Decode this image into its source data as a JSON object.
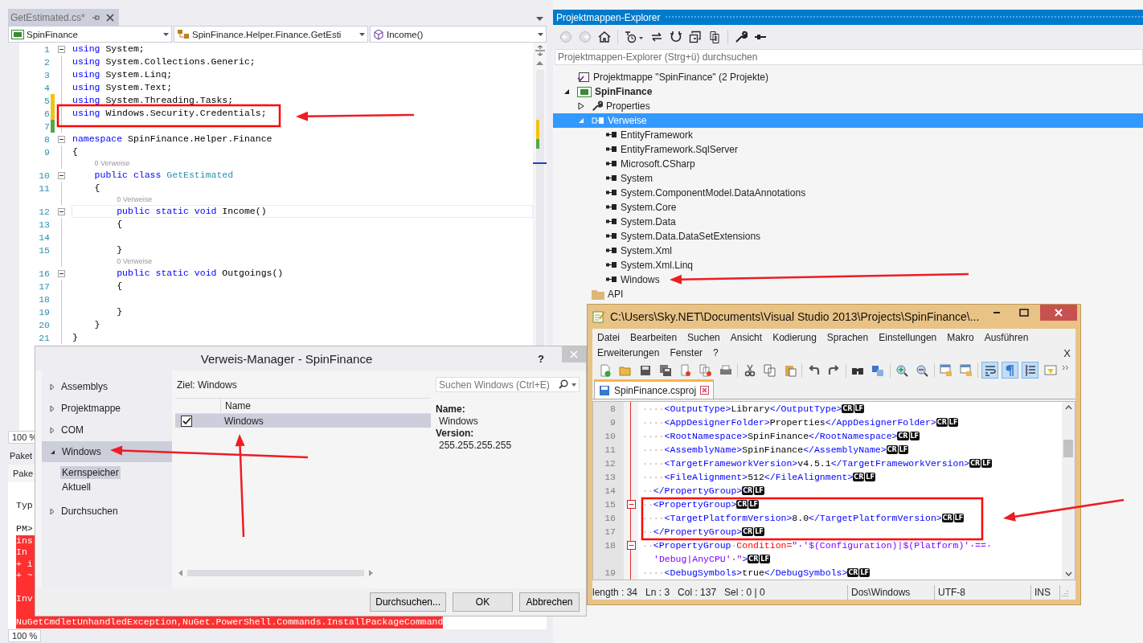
{
  "editor": {
    "tab": {
      "title": "GetEstimated.cs*",
      "selected": true
    },
    "navigation": [
      {
        "kind": "project",
        "text": "SpinFinance"
      },
      {
        "kind": "class",
        "text": "SpinFinance.Helper.Finance.GetEsti"
      },
      {
        "kind": "method",
        "text": "Income()"
      }
    ],
    "lines": [
      {
        "kind": "code",
        "number": "1",
        "fold": true,
        "modified": false,
        "current": false,
        "segments": [
          {
            "kind": "keyword",
            "text": "using"
          },
          {
            "kind": "plain",
            "text": " System;"
          }
        ]
      },
      {
        "kind": "code",
        "number": "2",
        "fold": false,
        "modified": false,
        "current": false,
        "segments": [
          {
            "kind": "keyword",
            "text": "using"
          },
          {
            "kind": "plain",
            "text": " System.Collections.Generic;"
          }
        ]
      },
      {
        "kind": "code",
        "number": "3",
        "fold": false,
        "modified": false,
        "current": false,
        "segments": [
          {
            "kind": "keyword",
            "text": "using"
          },
          {
            "kind": "plain",
            "text": " System.Linq;"
          }
        ]
      },
      {
        "kind": "code",
        "number": "4",
        "fold": false,
        "modified": false,
        "current": false,
        "segments": [
          {
            "kind": "keyword",
            "text": "using"
          },
          {
            "kind": "plain",
            "text": " System.Text;"
          }
        ]
      },
      {
        "kind": "code",
        "number": "5",
        "fold": false,
        "modified": true,
        "saved": false,
        "current": false,
        "segments": [
          {
            "kind": "keyword",
            "text": "using"
          },
          {
            "kind": "plain",
            "text": " System.Threading.Tasks;"
          }
        ]
      },
      {
        "kind": "code",
        "number": "6",
        "fold": false,
        "modified": true,
        "saved": false,
        "current": false,
        "segments": [
          {
            "kind": "keyword",
            "text": "using"
          },
          {
            "kind": "plain",
            "text": " Windows.Security.Credentials;"
          }
        ]
      },
      {
        "kind": "code",
        "number": "7",
        "fold": false,
        "modified": true,
        "saved": true,
        "current": false
      },
      {
        "kind": "code",
        "number": "8",
        "fold": true,
        "modified": false,
        "current": false,
        "segments": [
          {
            "kind": "keyword",
            "text": "namespace"
          },
          {
            "kind": "plain",
            "text": " SpinFinance.Helper.Finance"
          }
        ]
      },
      {
        "kind": "code",
        "number": "9",
        "fold": false,
        "modified": false,
        "current": false,
        "segments": [
          {
            "kind": "plain",
            "text": "{"
          }
        ]
      },
      {
        "kind": "codelens",
        "text": "0 Verweise"
      },
      {
        "kind": "code",
        "number": "10",
        "fold": true,
        "modified": false,
        "current": false,
        "segments": [
          {
            "kind": "keyword",
            "text": "    public class"
          },
          {
            "kind": "type",
            "text": " GetEstimated"
          }
        ]
      },
      {
        "kind": "code",
        "number": "11",
        "fold": false,
        "modified": false,
        "current": false,
        "segments": [
          {
            "kind": "plain",
            "text": "    {"
          }
        ]
      },
      {
        "kind": "codelens",
        "text": "0 Verweise"
      },
      {
        "kind": "code",
        "number": "12",
        "fold": true,
        "modified": false,
        "current": true,
        "segments": [
          {
            "kind": "keyword",
            "text": "        public static void"
          },
          {
            "kind": "plain",
            "text": " Income()"
          }
        ]
      },
      {
        "kind": "code",
        "number": "13",
        "fold": false,
        "modified": false,
        "current": false,
        "segments": [
          {
            "kind": "plain",
            "text": "        {"
          }
        ]
      },
      {
        "kind": "code",
        "number": "14",
        "fold": false,
        "modified": false,
        "current": false
      },
      {
        "kind": "code",
        "number": "15",
        "fold": false,
        "modified": false,
        "current": false,
        "segments": [
          {
            "kind": "plain",
            "text": "        }"
          }
        ]
      },
      {
        "kind": "codelens",
        "text": "0 Verweise"
      },
      {
        "kind": "code",
        "number": "16",
        "fold": true,
        "modified": false,
        "current": false,
        "segments": [
          {
            "kind": "keyword",
            "text": "        public static void"
          },
          {
            "kind": "plain",
            "text": " Outgoings()"
          }
        ]
      },
      {
        "kind": "code",
        "number": "17",
        "fold": false,
        "modified": false,
        "current": false,
        "segments": [
          {
            "kind": "plain",
            "text": "        {"
          }
        ]
      },
      {
        "kind": "code",
        "number": "18",
        "fold": false,
        "modified": false,
        "current": false
      },
      {
        "kind": "code",
        "number": "19",
        "fold": false,
        "modified": false,
        "current": false,
        "segments": [
          {
            "kind": "plain",
            "text": "        }"
          }
        ]
      },
      {
        "kind": "code",
        "number": "20",
        "fold": false,
        "modified": false,
        "current": false,
        "segments": [
          {
            "kind": "plain",
            "text": "    }"
          }
        ]
      },
      {
        "kind": "code",
        "number": "21",
        "fold": false,
        "modified": false,
        "current": false,
        "segments": [
          {
            "kind": "plain",
            "text": "}"
          }
        ]
      }
    ],
    "zoom": "100 %"
  },
  "console": {
    "title": "Paket",
    "toolbar_label": "Pake",
    "lines": [
      {
        "kind": "hint",
        "text": "Typ"
      },
      {
        "kind": "plain",
        "text": "PM>"
      },
      {
        "kind": "error",
        "text": "ins"
      },
      {
        "kind": "error",
        "text": "In"
      },
      {
        "kind": "error",
        "text": "+ i"
      },
      {
        "kind": "error",
        "text": "+ ~"
      },
      {
        "kind": "error"
      },
      {
        "kind": "error",
        "text": "Inv"
      },
      {
        "kind": "error"
      },
      {
        "kind": "error",
        "text": "NuGetCmdletUnhandledException,NuGet.PowerShell.Commands.InstallPackageCommand"
      }
    ],
    "zoom": "100 %"
  },
  "explorer": {
    "title": "Projektmappen-Explorer",
    "search": {
      "placeholder": "Projektmappen-Explorer (Strg+ü) durchsuchen"
    },
    "tree": [
      {
        "label": "Projektmappe \"SpinFinance\" (2 Projekte)",
        "kind": "solution",
        "selected": false,
        "children": [
          {
            "label": "SpinFinance",
            "kind": "project",
            "expanded": true,
            "selected": false,
            "children": [
              {
                "label": "Properties",
                "kind": "properties",
                "expanded": false,
                "selected": false
              },
              {
                "label": "Verweise",
                "kind": "references",
                "expanded": true,
                "selected": true,
                "children": [
                  {
                    "label": "EntityFramework",
                    "kind": "reference",
                    "selected": false
                  },
                  {
                    "label": "EntityFramework.SqlServer",
                    "kind": "reference",
                    "selected": false
                  },
                  {
                    "label": "Microsoft.CSharp",
                    "kind": "reference",
                    "selected": false
                  },
                  {
                    "label": "System",
                    "kind": "reference",
                    "selected": false
                  },
                  {
                    "label": "System.ComponentModel.DataAnnotations",
                    "kind": "reference",
                    "selected": false
                  },
                  {
                    "label": "System.Core",
                    "kind": "reference",
                    "selected": false
                  },
                  {
                    "label": "System.Data",
                    "kind": "reference",
                    "selected": false
                  },
                  {
                    "label": "System.Data.DataSetExtensions",
                    "kind": "reference",
                    "selected": false
                  },
                  {
                    "label": "System.Xml",
                    "kind": "reference",
                    "selected": false
                  },
                  {
                    "label": "System.Xml.Linq",
                    "kind": "reference",
                    "selected": false
                  },
                  {
                    "label": "Windows",
                    "kind": "reference",
                    "selected": false
                  }
                ]
              },
              {
                "label": "API",
                "kind": "folder",
                "selected": false
              }
            ]
          }
        ]
      }
    ]
  },
  "dialog": {
    "title": "Verweis-Manager - SpinFinance",
    "help": "?",
    "nav": [
      {
        "label": "Assemblys",
        "expanded": false,
        "selected": false
      },
      {
        "label": "Projektmappe",
        "expanded": false,
        "selected": false
      },
      {
        "label": "COM",
        "expanded": false,
        "selected": false
      },
      {
        "label": "Windows",
        "expanded": true,
        "selected": true,
        "children": [
          {
            "label": "Kernspeicher",
            "selected": true
          },
          {
            "label": "Aktuell",
            "selected": false
          }
        ]
      },
      {
        "label": "Durchsuchen",
        "expanded": false,
        "selected": false
      }
    ],
    "target": "Ziel: Windows",
    "columns": [
      "Name"
    ],
    "rows": [
      {
        "name": "Windows",
        "checked": true,
        "selected": true
      }
    ],
    "search": {
      "placeholder": "Suchen Windows (Ctrl+E)"
    },
    "details": [
      {
        "label": "Name:",
        "value": "Windows"
      },
      {
        "label": "Version:",
        "value": "255.255.255.255"
      }
    ],
    "buttons": [
      "Durchsuchen...",
      "OK",
      "Abbrechen"
    ]
  },
  "notepad": {
    "title": "C:\\Users\\Sky.NET\\Documents\\Visual Studio 2013\\Projects\\SpinFinance\\...",
    "menus": [
      "Datei",
      "Bearbeiten",
      "Suchen",
      "Ansicht",
      "Kodierung",
      "Sprachen",
      "Einstellungen",
      "Makro",
      "Ausführen",
      "Erweiterungen",
      "Fenster",
      "?"
    ],
    "close_document": "X",
    "toolbar": [
      {
        "kind": "new",
        "on": false
      },
      {
        "kind": "open",
        "on": false
      },
      {
        "kind": "save",
        "on": false
      },
      {
        "kind": "save-all",
        "on": false
      },
      {
        "kind": "close",
        "on": false
      },
      {
        "kind": "close-all",
        "on": false
      },
      {
        "kind": "print",
        "on": false
      },
      {
        "kind": "cut",
        "on": false
      },
      {
        "kind": "copy",
        "on": false
      },
      {
        "kind": "paste",
        "on": false
      },
      {
        "kind": "undo",
        "on": false
      },
      {
        "kind": "redo",
        "on": false
      },
      {
        "kind": "find",
        "on": false
      },
      {
        "kind": "replace",
        "on": false
      },
      {
        "kind": "zoom-in",
        "on": false
      },
      {
        "kind": "zoom-out",
        "on": false
      },
      {
        "kind": "sync-v",
        "on": false
      },
      {
        "kind": "sync-h",
        "on": false
      },
      {
        "kind": "wrap",
        "on": true
      },
      {
        "kind": "all-chars",
        "on": true
      },
      {
        "kind": "indent-guide",
        "on": true
      },
      {
        "kind": "panel",
        "on": false
      }
    ],
    "tab": {
      "title": "SpinFinance.csproj",
      "selected": true
    },
    "lines": [
      {
        "number": "8",
        "fold": false,
        "segments": [
          {
            "kind": "space",
            "text": "····"
          },
          {
            "kind": "tag",
            "text": "<OutputType>"
          },
          {
            "kind": "text",
            "text": "Library"
          },
          {
            "kind": "tag",
            "text": "</OutputType>"
          }
        ],
        "eol": [
          "CR",
          "LF"
        ]
      },
      {
        "number": "9",
        "fold": false,
        "segments": [
          {
            "kind": "space",
            "text": "····"
          },
          {
            "kind": "tag",
            "text": "<AppDesignerFolder>"
          },
          {
            "kind": "text",
            "text": "Properties"
          },
          {
            "kind": "tag",
            "text": "</AppDesignerFolder>"
          }
        ],
        "eol": [
          "CR",
          "LF"
        ]
      },
      {
        "number": "10",
        "fold": false,
        "segments": [
          {
            "kind": "space",
            "text": "····"
          },
          {
            "kind": "tag",
            "text": "<RootNamespace>"
          },
          {
            "kind": "text",
            "text": "SpinFinance"
          },
          {
            "kind": "tag",
            "text": "</RootNamespace>"
          }
        ],
        "eol": [
          "CR",
          "LF"
        ]
      },
      {
        "number": "11",
        "fold": false,
        "segments": [
          {
            "kind": "space",
            "text": "····"
          },
          {
            "kind": "tag",
            "text": "<AssemblyName>"
          },
          {
            "kind": "text",
            "text": "SpinFinance"
          },
          {
            "kind": "tag",
            "text": "</AssemblyName>"
          }
        ],
        "eol": [
          "CR",
          "LF"
        ]
      },
      {
        "number": "12",
        "fold": false,
        "segments": [
          {
            "kind": "space",
            "text": "····"
          },
          {
            "kind": "tag",
            "text": "<TargetFrameworkVersion>"
          },
          {
            "kind": "text",
            "text": "v4.5.1"
          },
          {
            "kind": "tag",
            "text": "</TargetFrameworkVersion>"
          }
        ],
        "eol": [
          "CR",
          "LF"
        ]
      },
      {
        "number": "13",
        "fold": false,
        "segments": [
          {
            "kind": "space",
            "text": "····"
          },
          {
            "kind": "tag",
            "text": "<FileAlignment>"
          },
          {
            "kind": "text",
            "text": "512"
          },
          {
            "kind": "tag",
            "text": "</FileAlignment>"
          }
        ],
        "eol": [
          "CR",
          "LF"
        ]
      },
      {
        "number": "14",
        "fold": false,
        "segments": [
          {
            "kind": "space",
            "text": "··"
          },
          {
            "kind": "tag",
            "text": "</PropertyGroup>"
          }
        ],
        "eol": [
          "CR",
          "LF"
        ]
      },
      {
        "number": "15",
        "fold": true,
        "segments": [
          {
            "kind": "space",
            "text": "··"
          },
          {
            "kind": "tag",
            "text": "<PropertyGroup>"
          }
        ],
        "eol": [
          "CR",
          "LF"
        ]
      },
      {
        "number": "16",
        "fold": false,
        "segments": [
          {
            "kind": "space",
            "text": "····"
          },
          {
            "kind": "tag",
            "text": "<TargetPlatformVersion>"
          },
          {
            "kind": "text",
            "text": "8.0"
          },
          {
            "kind": "tag",
            "text": "</TargetPlatformVersion>"
          }
        ],
        "eol": [
          "CR",
          "LF"
        ]
      },
      {
        "number": "17",
        "fold": false,
        "segments": [
          {
            "kind": "space",
            "text": "··"
          },
          {
            "kind": "tag",
            "text": "</PropertyGroup>"
          }
        ],
        "eol": [
          "CR",
          "LF"
        ]
      },
      {
        "number": "18",
        "fold": true,
        "segments": [
          {
            "kind": "space",
            "text": "··"
          },
          {
            "kind": "tag",
            "text": "<PropertyGroup"
          },
          {
            "kind": "space",
            "text": "·"
          },
          {
            "kind": "attr",
            "text": "Condition="
          },
          {
            "kind": "value",
            "text": "\"·'$(Configuration)|$(Platform)'·==·"
          }
        ],
        "wrap": [
          {
            "kind": "value",
            "text": "'Debug|AnyCPU'·\""
          },
          {
            "kind": "tag",
            "text": ">"
          }
        ],
        "eol": [
          "CR",
          "LF"
        ]
      },
      {
        "number": "19",
        "fold": false,
        "segments": [
          {
            "kind": "space",
            "text": "····"
          },
          {
            "kind": "tag",
            "text": "<DebugSymbols>"
          },
          {
            "kind": "text",
            "text": "true"
          },
          {
            "kind": "tag",
            "text": "</DebugSymbols>"
          }
        ],
        "eol": [
          "CR",
          "LF"
        ]
      }
    ],
    "status": {
      "length": "length : 34",
      "line": "Ln : 3",
      "column": "Col : 137",
      "selection": "Sel : 0 | 0",
      "eol_format": "Dos\\Windows",
      "encoding": "UTF-8",
      "mode": "INS"
    }
  }
}
